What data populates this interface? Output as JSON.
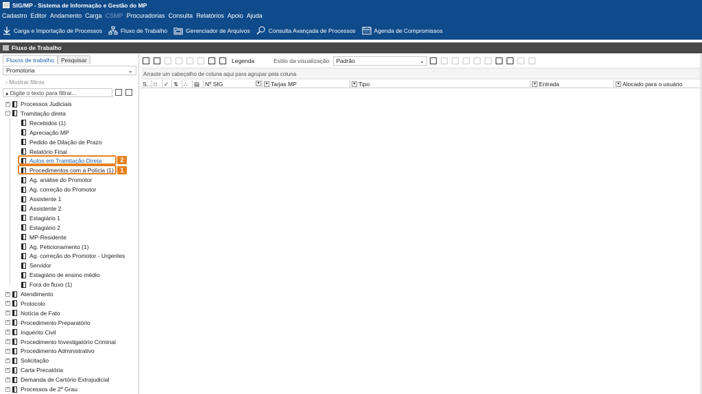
{
  "title": "SIG/MP - Sistema de Informação e Gestão do MP",
  "menu": [
    "Cadastro",
    "Editor",
    "Andamento",
    "Carga",
    "CSMP",
    "Procuradorias",
    "Consulta",
    "Relatórios",
    "Apoio",
    "Ajuda"
  ],
  "menu_disabled": "CSMP",
  "toolbar": {
    "carga": "Carga e Importação de Processos",
    "fluxo": "Fluxo de Trabalho",
    "arquivos": "Gerenciador de Arquivos",
    "consulta": "Consulta Avançada de Processos",
    "agenda": "Agenda de Compromissos"
  },
  "section_title": "Fluxo de Trabalho",
  "left": {
    "tabs": [
      "Fluxos de trabalho",
      "Pesquisar"
    ],
    "combo_value": "Promotoria",
    "show_filters": "Mostrar filtros",
    "filter_placeholder": "Digite o texto para filtrar..."
  },
  "tree": [
    {
      "label": "Processos Judiciais",
      "level": 0,
      "expander": "+"
    },
    {
      "label": "Tramitação direta",
      "level": 0,
      "expander": "-"
    },
    {
      "label": "Recebidos (1)",
      "level": 1
    },
    {
      "label": "Apreciação MP",
      "level": 1
    },
    {
      "label": "Pedido de Dilação de Prazo",
      "level": 1
    },
    {
      "label": "Relatório Final",
      "level": 1
    },
    {
      "label": "Autos em Tramitação Direta",
      "level": 1
    },
    {
      "label": "Procedimentos com a Polícia (1)",
      "level": 1
    },
    {
      "label": "Ag. análise do Promotor",
      "level": 1
    },
    {
      "label": "Ag. correção do Promotor",
      "level": 1
    },
    {
      "label": "Assistente 1",
      "level": 1
    },
    {
      "label": "Assistente 2",
      "level": 1
    },
    {
      "label": "Estagiário 1",
      "level": 1
    },
    {
      "label": "Estagiário 2",
      "level": 1
    },
    {
      "label": "MP-Residente",
      "level": 1
    },
    {
      "label": "Ag. Peticionamento (1)",
      "level": 1
    },
    {
      "label": "Ag. correção do Promotor - Urgentes",
      "level": 1
    },
    {
      "label": "Servidor",
      "level": 1
    },
    {
      "label": "Estagiário de ensino médio",
      "level": 1
    },
    {
      "label": "Fora do fluxo (1)",
      "level": 1
    },
    {
      "label": "Atendimento",
      "level": 0,
      "expander": "+"
    },
    {
      "label": "Protocolo",
      "level": 0,
      "expander": "+"
    },
    {
      "label": "Notícia de Fato",
      "level": 0,
      "expander": "+"
    },
    {
      "label": "Procedimento Preparatório",
      "level": 0,
      "expander": "+"
    },
    {
      "label": "Inquérito Civil",
      "level": 0,
      "expander": "+"
    },
    {
      "label": "Procedimento Investigatório Criminal",
      "level": 0,
      "expander": "+"
    },
    {
      "label": "Procedimento Administrativo",
      "level": 0,
      "expander": "+"
    },
    {
      "label": "Solicitação",
      "level": 0,
      "expander": "+"
    },
    {
      "label": "Carta Precatória",
      "level": 0,
      "expander": "+"
    },
    {
      "label": "Demanda de Cartório Extrajudicial",
      "level": 0,
      "expander": "+"
    },
    {
      "label": "Processos de 2º Grau",
      "level": 0,
      "expander": "+"
    }
  ],
  "badges": {
    "first": "1",
    "second": "2"
  },
  "right": {
    "legend": "Legenda",
    "style_label": "Estilo da visualização",
    "style_value": "Padrão",
    "group_hint": "Arraste um cabeçalho de coluna aqui para agrupar pela coluna",
    "columns": [
      "S...",
      "Nº SIG",
      "Tarjas MP",
      "Tipo",
      "Entrada",
      "Alocado para o usuário"
    ]
  },
  "colors": {
    "header_blue": "#0f4a8a",
    "highlight_orange": "#e8801e"
  }
}
